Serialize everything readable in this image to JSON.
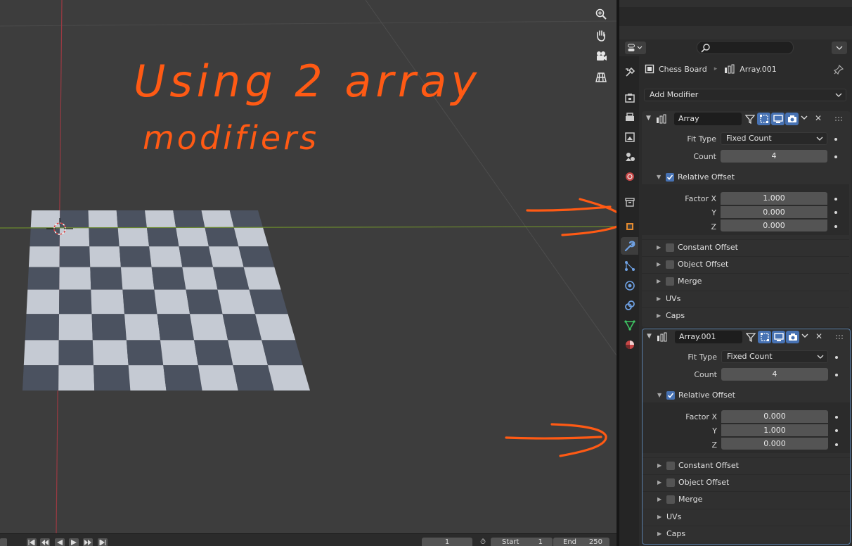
{
  "viewport": {
    "nav_tools": [
      "zoom-icon",
      "hand-pan-icon",
      "camera-icon",
      "grid-ortho-icon"
    ],
    "annotation": {
      "line1": "Using 2 array",
      "line2": "modifiers",
      "color": "#ff5a14"
    },
    "checkerboard": {
      "rows": 8,
      "cols": 8,
      "light": "#c5cad3",
      "dark": "#4b5260"
    }
  },
  "timeline": {
    "current_frame": "1",
    "start_label": "Start",
    "start_value": "1",
    "end_label": "End",
    "end_value": "250"
  },
  "props": {
    "breadcrumb": {
      "object": "Chess Board",
      "modifier": "Array.001"
    },
    "add_modifier": "Add Modifier",
    "modifiers": [
      {
        "name": "Array",
        "fit_type_label": "Fit Type",
        "fit_type": "Fixed Count",
        "count_label": "Count",
        "count": "4",
        "relative_offset_label": "Relative Offset",
        "relative_offset_enabled": true,
        "factor_x_label": "Factor X",
        "factor_y_label": "Y",
        "factor_z_label": "Z",
        "factor_x": "1.000",
        "factor_y": "0.000",
        "factor_z": "0.000",
        "constant_offset": "Constant Offset",
        "object_offset": "Object Offset",
        "merge": "Merge",
        "uvs": "UVs",
        "caps": "Caps"
      },
      {
        "name": "Array.001",
        "fit_type_label": "Fit Type",
        "fit_type": "Fixed Count",
        "count_label": "Count",
        "count": "4",
        "relative_offset_label": "Relative Offset",
        "relative_offset_enabled": true,
        "factor_x_label": "Factor X",
        "factor_y_label": "Y",
        "factor_z_label": "Z",
        "factor_x": "0.000",
        "factor_y": "1.000",
        "factor_z": "0.000",
        "constant_offset": "Constant Offset",
        "object_offset": "Object Offset",
        "merge": "Merge",
        "uvs": "UVs",
        "caps": "Caps"
      }
    ],
    "tabs": [
      "tool",
      "render",
      "output",
      "view-layer",
      "scene",
      "world",
      "collection",
      "object",
      "modifiers",
      "particles",
      "physics",
      "constraints",
      "data",
      "material"
    ],
    "active_tab": "modifiers"
  }
}
